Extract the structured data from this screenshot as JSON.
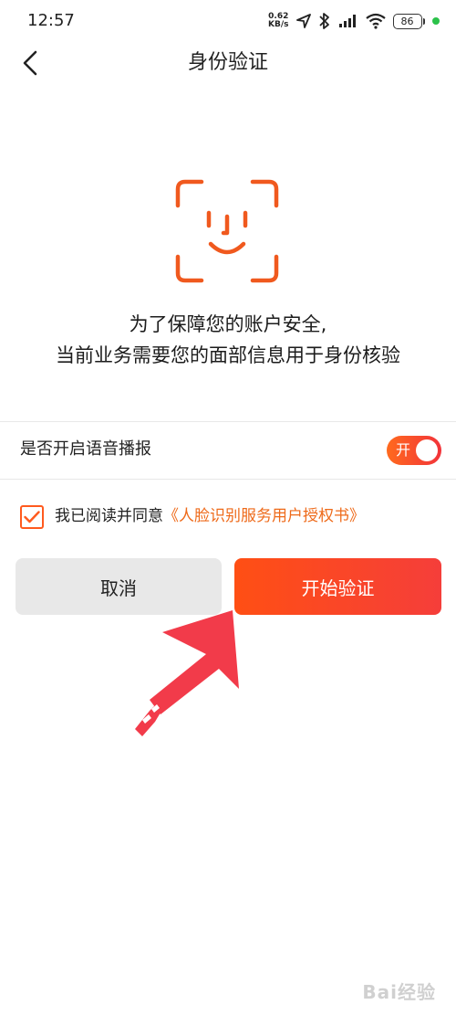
{
  "status_bar": {
    "time": "12:57",
    "net_speed_value": "0.62",
    "net_speed_unit": "KB/s",
    "battery": "86",
    "icons": [
      "location-icon",
      "bluetooth-icon",
      "signal-icon",
      "wifi-icon",
      "battery-icon"
    ]
  },
  "nav": {
    "title": "身份验证",
    "back_icon": "chevron-left-icon"
  },
  "face_icon": "face-scan-icon",
  "message": {
    "line1": "为了保障您的账户安全,",
    "line2": "当前业务需要您的面部信息用于身份核验"
  },
  "voice": {
    "label": "是否开启语音播报",
    "toggle_text": "开",
    "enabled": true
  },
  "agreement": {
    "checked": true,
    "text": "我已阅读并同意",
    "link": "《人脸识别服务用户授权书》"
  },
  "buttons": {
    "cancel": "取消",
    "start": "开始验证"
  },
  "watermark": "Bai经验",
  "colors": {
    "accent": "#ff5a1e",
    "accent_end": "#f2333a",
    "link": "#ee6a1a",
    "cancel_bg": "#e8e8e8",
    "annotation_arrow": "#f23b4a"
  }
}
